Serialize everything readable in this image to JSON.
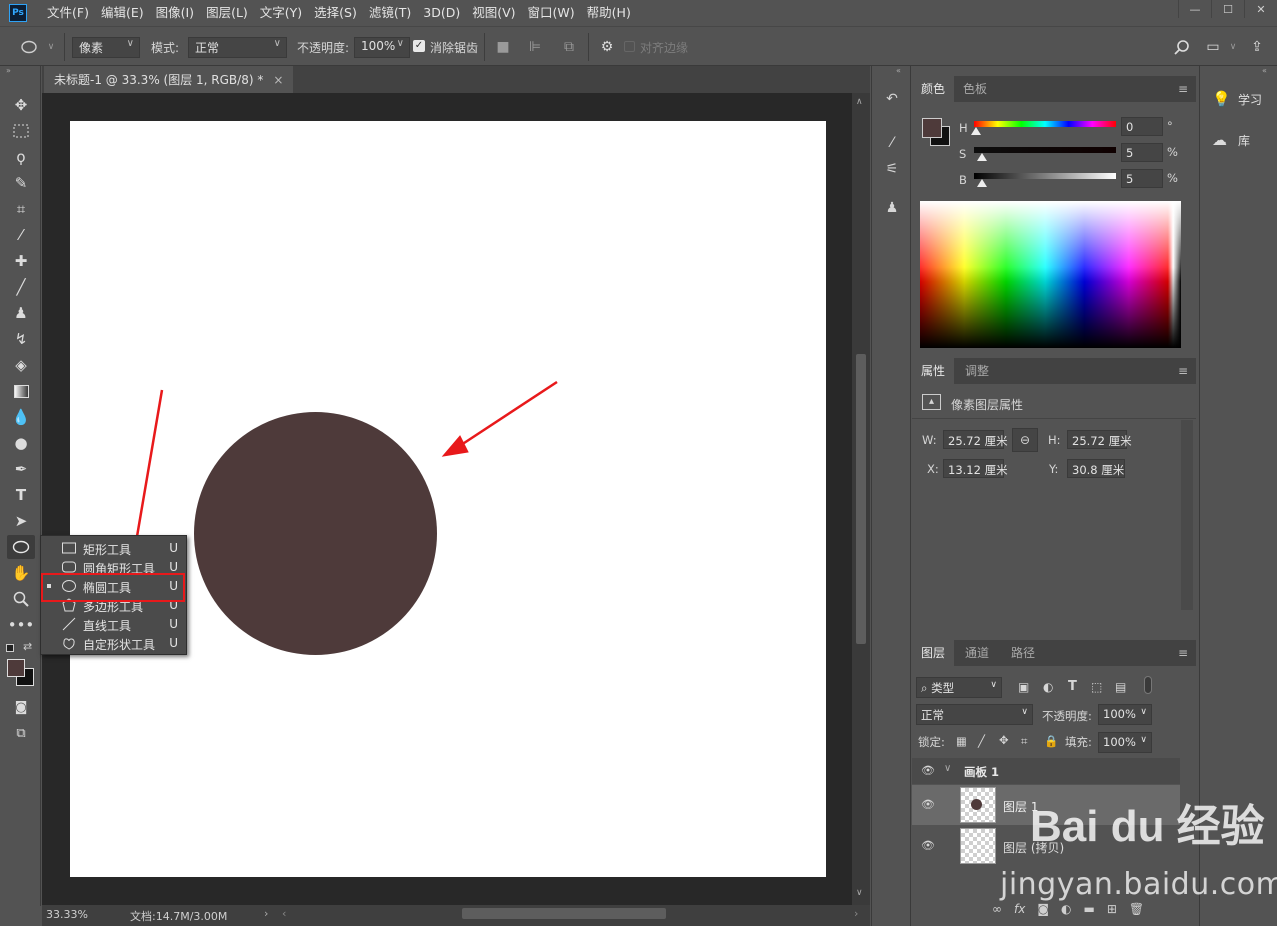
{
  "app": {
    "logo": "Ps"
  },
  "menu": [
    "文件(F)",
    "编辑(E)",
    "图像(I)",
    "图层(L)",
    "文字(Y)",
    "选择(S)",
    "滤镜(T)",
    "3D(D)",
    "视图(V)",
    "窗口(W)",
    "帮助(H)"
  ],
  "options": {
    "fill_type": "像素",
    "mode_label": "模式:",
    "mode_value": "正常",
    "opacity_label": "不透明度:",
    "opacity_value": "100%",
    "antialias_label": "消除锯齿",
    "align_edges_label": "对齐边缘"
  },
  "document": {
    "tab_title": "未标题-1 @ 33.3% (图层 1, RGB/8) *",
    "zoom": "33.33%",
    "doc_size": "文档:14.7M/3.00M",
    "shape_color": "#4e3a3a"
  },
  "flyout": {
    "items": [
      {
        "label": "矩形工具",
        "key": "U"
      },
      {
        "label": "圆角矩形工具",
        "key": "U"
      },
      {
        "label": "椭圆工具",
        "key": "U"
      },
      {
        "label": "多边形工具",
        "key": "U"
      },
      {
        "label": "直线工具",
        "key": "U"
      },
      {
        "label": "自定形状工具",
        "key": "U"
      }
    ]
  },
  "color_panel": {
    "tabs": [
      "颜色",
      "色板"
    ],
    "h_label": "H",
    "h_value": "0",
    "h_unit": "°",
    "s_label": "S",
    "s_value": "5",
    "s_unit": "%",
    "b_label": "B",
    "b_value": "5",
    "b_unit": "%",
    "foreground": "#4e3a3a",
    "background": "#111111"
  },
  "properties_panel": {
    "tabs": [
      "属性",
      "调整"
    ],
    "section_title": "像素图层属性",
    "w_label": "W:",
    "w_value": "25.72 厘米",
    "h_label": "H:",
    "h_value": "25.72 厘米",
    "x_label": "X:",
    "x_value": "13.12 厘米",
    "y_label": "Y:",
    "y_value": "30.8 厘米"
  },
  "layers_panel": {
    "tabs": [
      "图层",
      "通道",
      "路径"
    ],
    "filter_label": "类型",
    "blend_mode": "正常",
    "opacity_label": "不透明度:",
    "opacity_value": "100%",
    "lock_label": "锁定:",
    "fill_label": "填充:",
    "fill_value": "100%",
    "artboard_name": "画板 1",
    "layers": [
      {
        "name": "图层 1"
      },
      {
        "name": "图层 (拷贝)"
      }
    ]
  },
  "right_dock": {
    "items": [
      "学习",
      "库"
    ]
  },
  "watermark": {
    "logo": "Bai du 经验",
    "url": "jingyan.baidu.com"
  }
}
